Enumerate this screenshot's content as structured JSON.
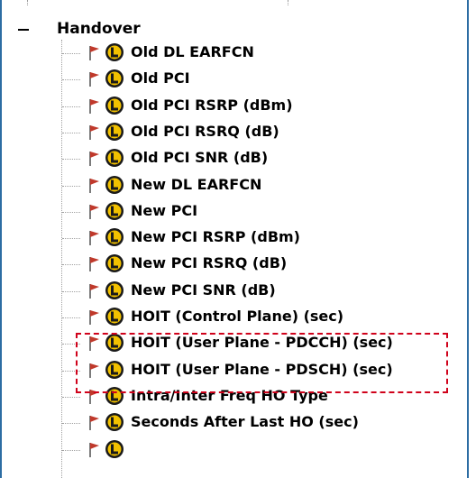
{
  "tree": {
    "parent": {
      "label": "Handover",
      "expander": "minus-icon"
    },
    "children": [
      {
        "label": "Old DL EARFCN",
        "flag": "red-flag-icon",
        "icon": "layer3-L-icon"
      },
      {
        "label": "Old PCI",
        "flag": "red-flag-icon",
        "icon": "layer3-L-icon"
      },
      {
        "label": "Old PCI RSRP (dBm)",
        "flag": "red-flag-icon",
        "icon": "layer3-L-icon"
      },
      {
        "label": "Old PCI RSRQ (dB)",
        "flag": "red-flag-icon",
        "icon": "layer3-L-icon"
      },
      {
        "label": "Old PCI SNR (dB)",
        "flag": "red-flag-icon",
        "icon": "layer3-L-icon"
      },
      {
        "label": "New DL EARFCN",
        "flag": "red-flag-icon",
        "icon": "layer3-L-icon"
      },
      {
        "label": "New PCI",
        "flag": "red-flag-icon",
        "icon": "layer3-L-icon"
      },
      {
        "label": "New PCI RSRP (dBm)",
        "flag": "red-flag-icon",
        "icon": "layer3-L-icon"
      },
      {
        "label": "New PCI RSRQ (dB)",
        "flag": "red-flag-icon",
        "icon": "layer3-L-icon"
      },
      {
        "label": "New PCI SNR (dB)",
        "flag": "red-flag-icon",
        "icon": "layer3-L-icon"
      },
      {
        "label": "HOIT (Control Plane) (sec)",
        "flag": "red-flag-icon",
        "icon": "layer3-L-icon"
      },
      {
        "label": "HOIT (User Plane - PDCCH) (sec)",
        "flag": "red-flag-icon",
        "icon": "layer3-L-icon"
      },
      {
        "label": "HOIT (User Plane - PDSCH) (sec)",
        "flag": "red-flag-icon",
        "icon": "layer3-L-icon"
      },
      {
        "label": "Intra/Inter Freq HO Type",
        "flag": "red-flag-icon",
        "icon": "layer3-L-icon"
      },
      {
        "label": "Seconds After Last HO (sec)",
        "flag": "red-flag-icon",
        "icon": "layer3-L-icon"
      },
      {
        "label": "",
        "flag": "red-flag-icon",
        "icon": "layer3-L-icon"
      }
    ]
  },
  "colors": {
    "panel_border": "#2d6da3",
    "highlight": "#d0021b",
    "flag": "#c0392b",
    "icon_fill": "#f2c100"
  }
}
